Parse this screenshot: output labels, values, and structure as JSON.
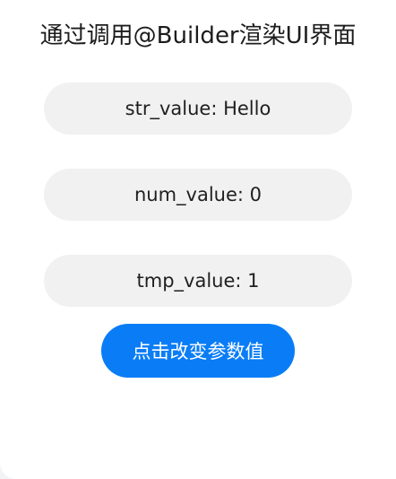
{
  "page": {
    "title": "通过调用@Builder渲染UI界面"
  },
  "values": {
    "str_value": "str_value: Hello",
    "num_value": "num_value: 0",
    "tmp_value": "tmp_value: 1"
  },
  "actions": {
    "change_button_label": "点击改变参数值"
  },
  "colors": {
    "accent": "#0a7df6",
    "row_background": "#f1f1f1"
  }
}
